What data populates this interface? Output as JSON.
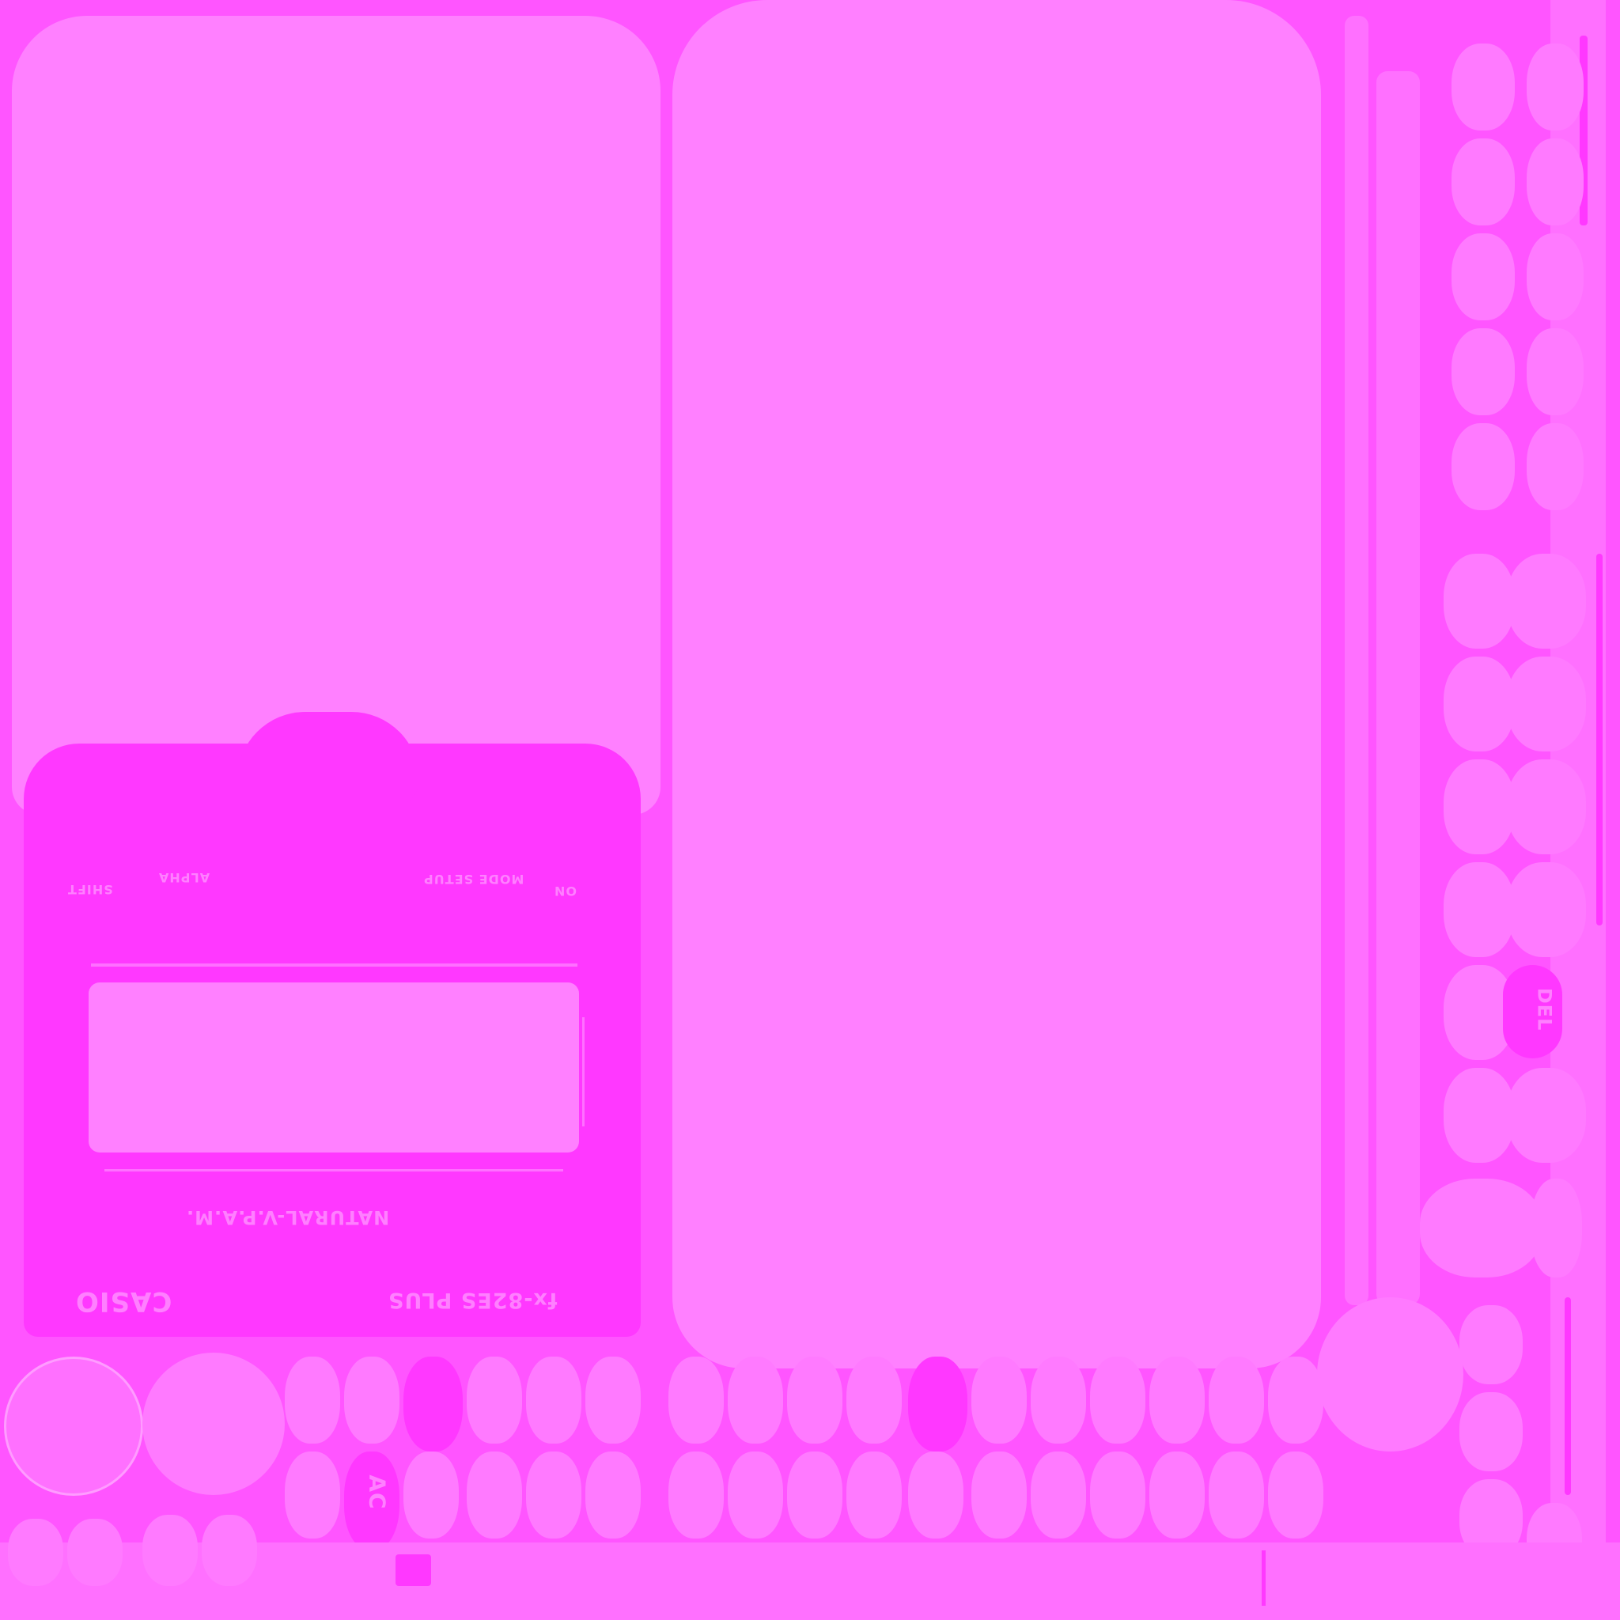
{
  "texture": {
    "brand": "CASIO",
    "model": "fx-82ES PLUS",
    "tagline": "NATURAL-V.P.A.M.",
    "top_labels": {
      "shift": "SHIFT",
      "alpha": "ALPHA",
      "mode_setup": "MODE SETUP",
      "on": "ON"
    },
    "keys": {
      "del": "DEL",
      "ac": "AC"
    },
    "colors": {
      "background": "#ff55ff",
      "surface": "#ff80ff",
      "highlight": "#ff38ff"
    }
  }
}
